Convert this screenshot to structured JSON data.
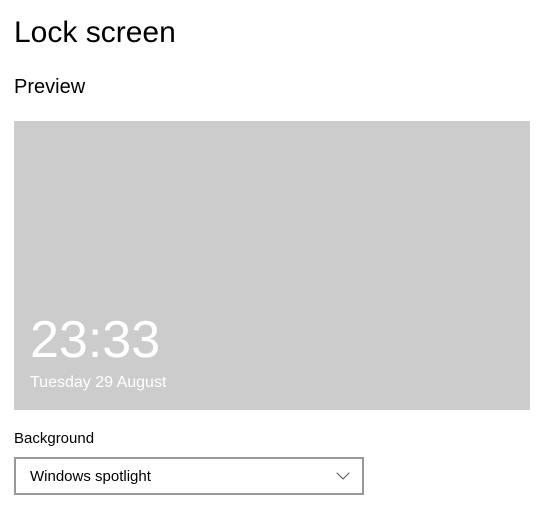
{
  "page": {
    "title": "Lock screen"
  },
  "preview": {
    "label": "Preview",
    "time": "23:33",
    "date": "Tuesday 29 August"
  },
  "background": {
    "label": "Background",
    "selected": "Windows spotlight"
  }
}
